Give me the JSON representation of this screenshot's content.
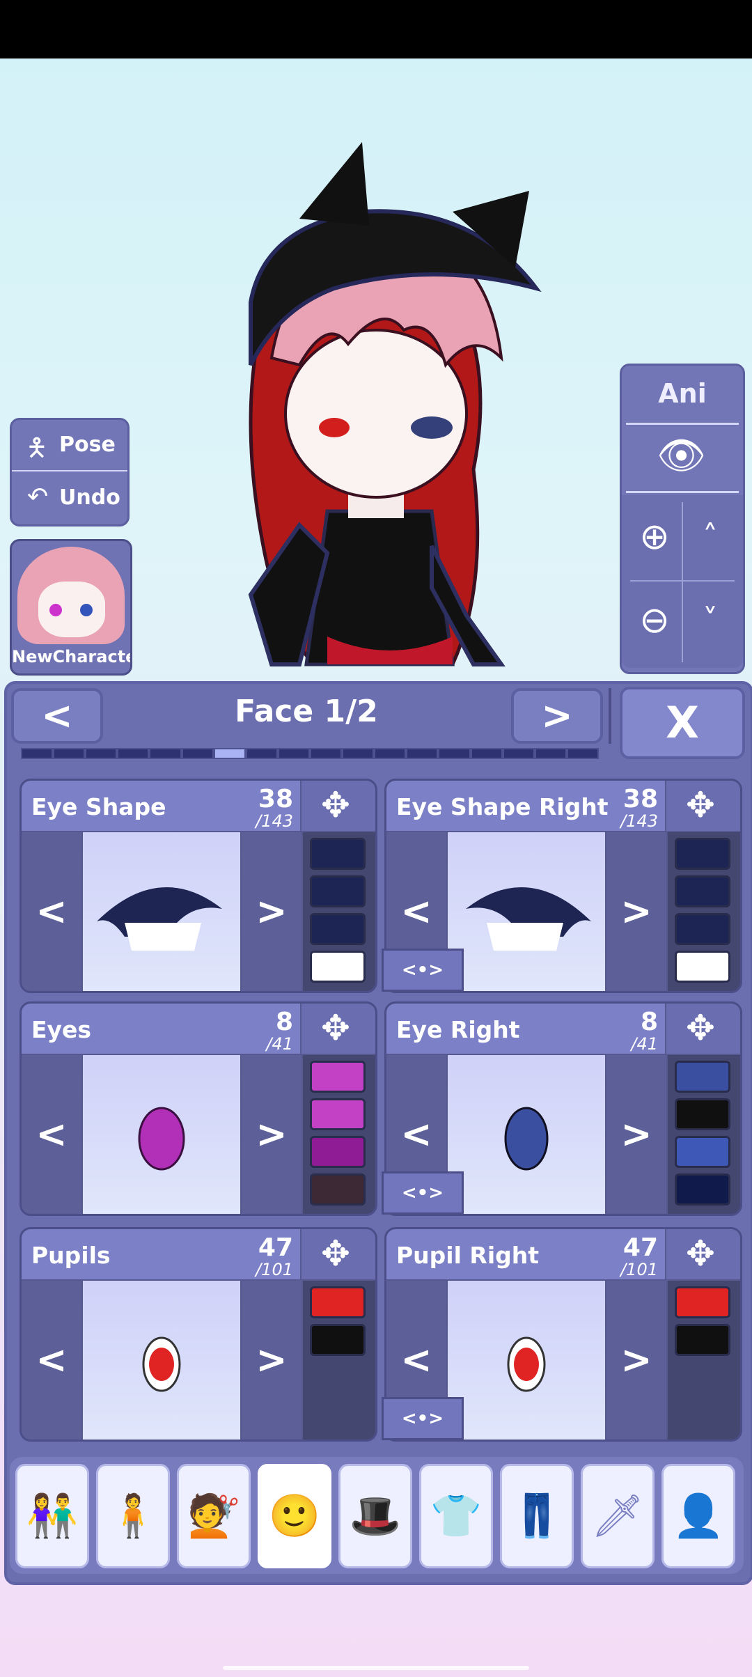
{
  "side_panel": {
    "pose_label": "Pose",
    "undo_label": "Undo",
    "character_name": "NewCharacter"
  },
  "right_panel": {
    "ani_label": "Ani"
  },
  "header": {
    "title": "Face 1/2",
    "prev_label": "<",
    "next_label": ">",
    "close_label": "X"
  },
  "page_progress": {
    "total": 18,
    "active_index": 6
  },
  "cards": [
    {
      "title": "Eye Shape",
      "num": "38",
      "den": "/143",
      "prev": "<",
      "next": ">",
      "swatches": [
        "#1c2554",
        "#1c2554",
        "#1c2554",
        "#ffffff"
      ]
    },
    {
      "title": "Eye Shape Right",
      "num": "38",
      "den": "/143",
      "prev": "<",
      "next": ">",
      "swatches": [
        "#1c2554",
        "#1c2554",
        "#1c2554",
        "#ffffff"
      ]
    },
    {
      "title": "Eyes",
      "num": "8",
      "den": "/41",
      "prev": "<",
      "next": ">",
      "swatches": [
        "#c341c4",
        "#c341c4",
        "#8f1c94",
        "#3d2935"
      ]
    },
    {
      "title": "Eye Right",
      "num": "8",
      "den": "/41",
      "prev": "<",
      "next": ">",
      "swatches": [
        "#3a4fa0",
        "#101010",
        "#3e58b8",
        "#101a4b"
      ]
    },
    {
      "title": "Pupils",
      "num": "47",
      "den": "/101",
      "prev": "<",
      "next": ">",
      "swatches": [
        "#e02424",
        "#101010"
      ]
    },
    {
      "title": "Pupil Right",
      "num": "47",
      "den": "/101",
      "prev": "<",
      "next": ">",
      "swatches": [
        "#e02424",
        "#101010"
      ]
    }
  ],
  "mirror_label": "<•>",
  "bottom_tabs": [
    "presets-icon",
    "body-icon",
    "hair-icon",
    "face-icon",
    "accessories-icon",
    "top-icon",
    "bottom-icon",
    "weapons-icon",
    "profile-icon"
  ],
  "active_tab_index": 3
}
